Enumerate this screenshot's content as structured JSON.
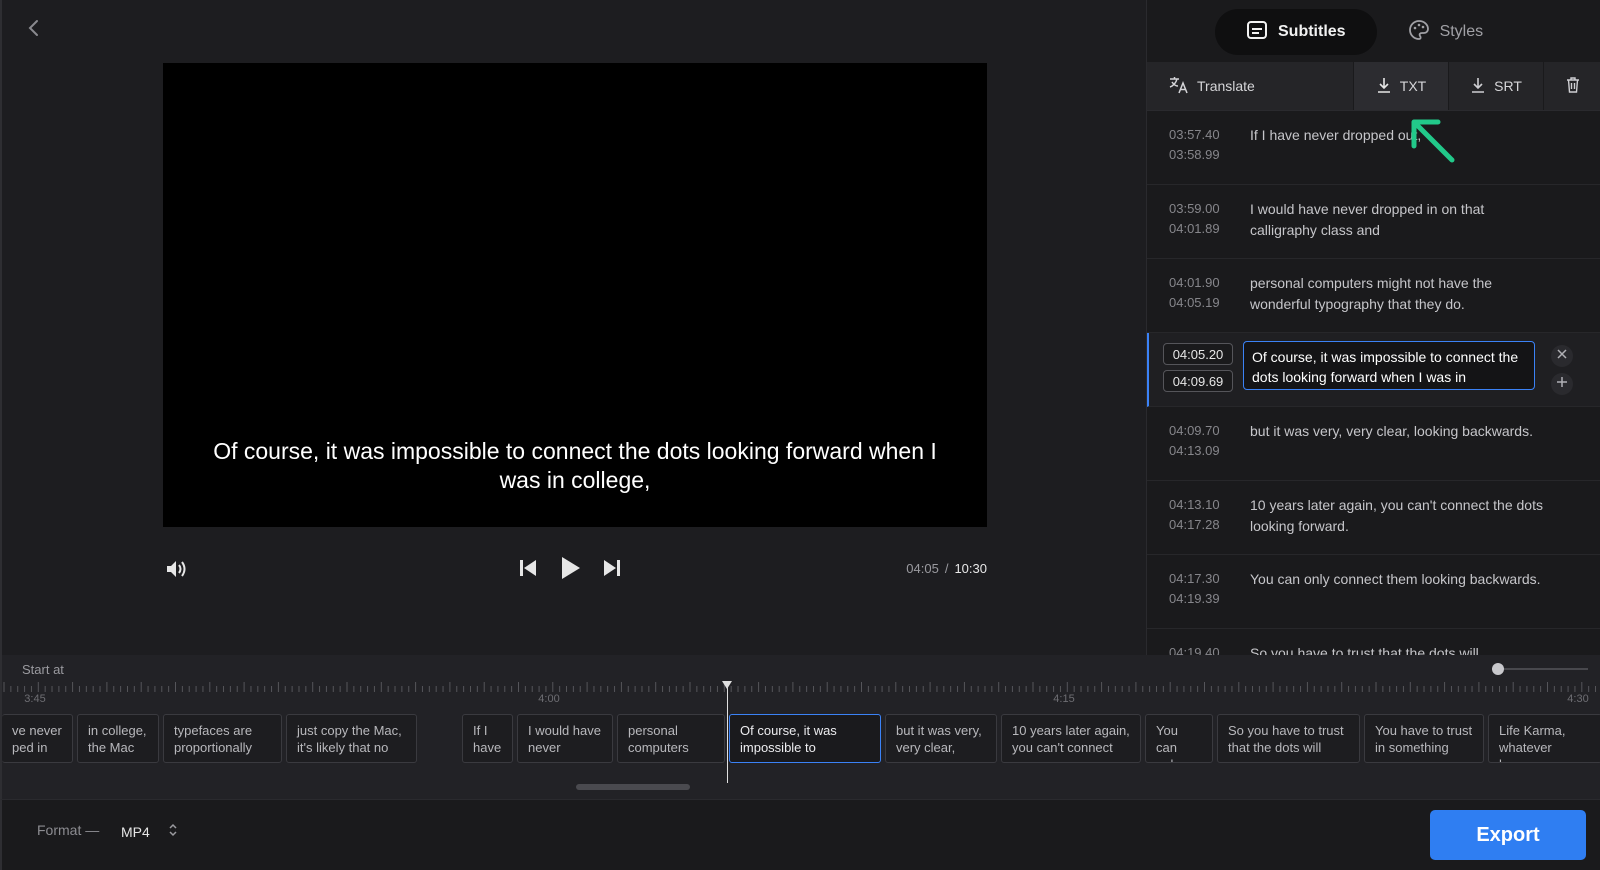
{
  "player": {
    "caption": "Of course, it was impossible to connect the dots looking forward when I was in college,",
    "current_time": "04:05",
    "separator": "/",
    "total_time": "10:30"
  },
  "panel": {
    "tabs": [
      {
        "label": "Subtitles",
        "icon": "subtitles-icon",
        "active": true
      },
      {
        "label": "Styles",
        "icon": "palette-icon",
        "active": false
      }
    ],
    "toolbar": {
      "translate_label": "Translate",
      "txt_label": "TXT",
      "srt_label": "SRT"
    },
    "rows": [
      {
        "start": "03:57.40",
        "end": "03:58.99",
        "text": "If I have never dropped out,"
      },
      {
        "start": "03:59.00",
        "end": "04:01.89",
        "text": "I would have never dropped in on that calligraphy class and"
      },
      {
        "start": "04:01.90",
        "end": "04:05.19",
        "text": "personal computers might not have the wonderful typography that they do."
      },
      {
        "start": "04:05.20",
        "end": "04:09.69",
        "text": "Of course, it was impossible to connect the dots looking forward when I was in"
      },
      {
        "start": "04:09.70",
        "end": "04:13.09",
        "text": "but it was very, very clear, looking backwards."
      },
      {
        "start": "04:13.10",
        "end": "04:17.28",
        "text": "10 years later again, you can't connect the dots looking forward."
      },
      {
        "start": "04:17.30",
        "end": "04:19.39",
        "text": "You can only connect them looking backwards."
      },
      {
        "start": "04:19.40",
        "end": "",
        "text": "So you have to trust that the dots will"
      }
    ]
  },
  "timeline": {
    "start_at_label": "Start at",
    "tick_labels": [
      "3:45",
      "4:00",
      "4:15",
      "4:30"
    ],
    "segments": [
      "ve never\nped in on",
      "in college,\nthe Mac",
      "typefaces are\nproportionally",
      "just copy the Mac,\nit's likely that no",
      "If I\nhave",
      "I would have\nnever",
      "personal\ncomputers",
      "Of course, it was\nimpossible to",
      "but it was very,\nvery clear,",
      "10 years later again,\nyou can't connect",
      "You can\nonly",
      "So you have to trust\nthat the dots will",
      "You have to trust\nin something",
      "Life Karma,\nwhatever becaus"
    ]
  },
  "bottom": {
    "format_label": "Format —",
    "format_value": "MP4",
    "export_label": "Export"
  },
  "colors": {
    "accent": "#2f7ef2",
    "annotation_arrow": "#22c98a"
  }
}
